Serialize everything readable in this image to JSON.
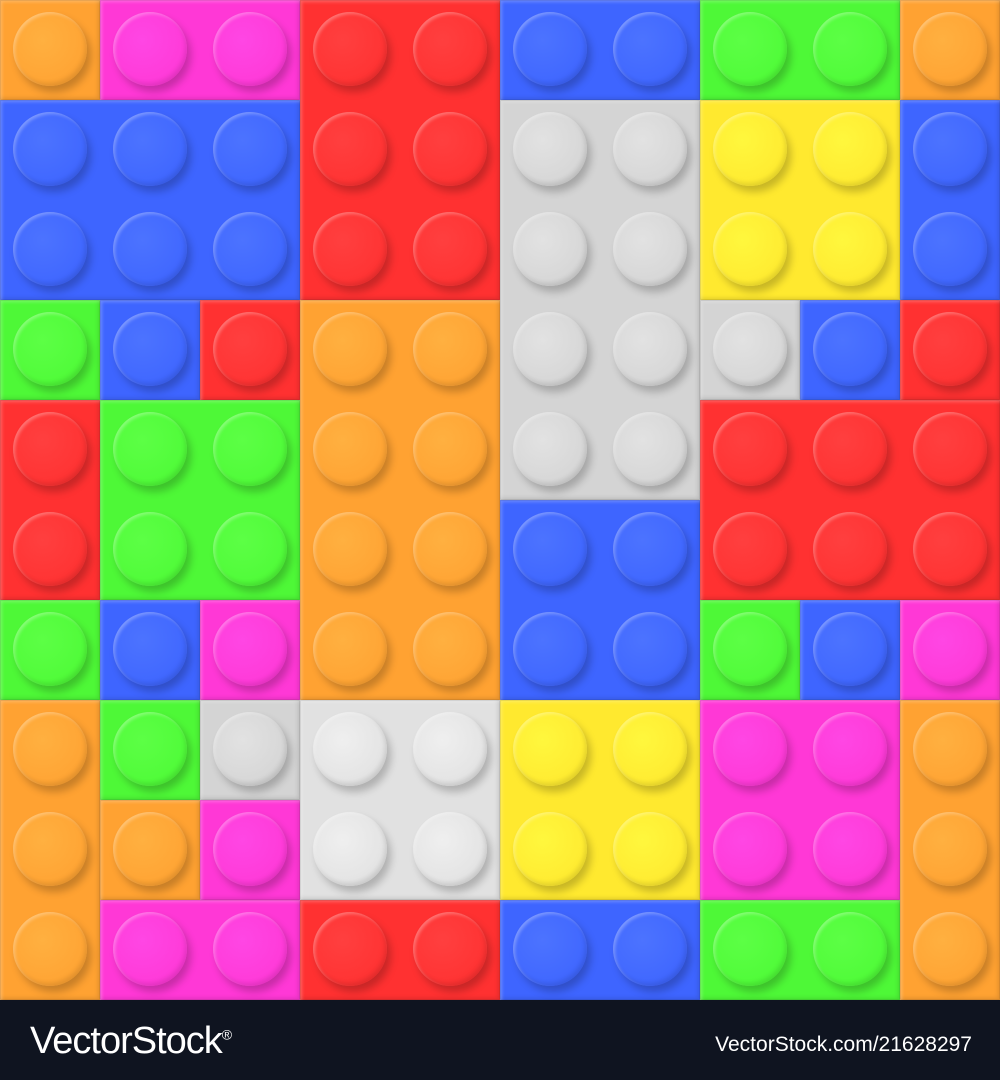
{
  "colors": {
    "orange": "#FFA232",
    "magenta": "#FF38D6",
    "red": "#FF3131",
    "blue": "#3E65FF",
    "green": "#4EF837",
    "gray": "#D4D4D4",
    "yellow": "#FFE92F",
    "lightgray": "#E1E1E1",
    "footer_bg": "#0f1420",
    "footer_text": "#ffffff"
  },
  "bricks": [
    {
      "color": "orange",
      "studs": "1x1"
    },
    {
      "color": "magenta",
      "studs": "2x1"
    },
    {
      "color": "red",
      "studs": "2x3"
    },
    {
      "color": "blue",
      "studs": "2x1"
    },
    {
      "color": "green",
      "studs": "2x1"
    },
    {
      "color": "orange",
      "studs": "1x1"
    },
    {
      "color": "blue",
      "studs": "3x2"
    },
    {
      "color": "gray",
      "studs": "2x4"
    },
    {
      "color": "yellow",
      "studs": "2x2"
    },
    {
      "color": "blue",
      "studs": "1x2"
    },
    {
      "color": "green",
      "studs": "1x1"
    },
    {
      "color": "blue",
      "studs": "1x1"
    },
    {
      "color": "red",
      "studs": "1x1"
    },
    {
      "color": "orange",
      "studs": "2x4"
    },
    {
      "color": "gray",
      "studs": "1x1"
    },
    {
      "color": "blue",
      "studs": "1x1"
    },
    {
      "color": "red",
      "studs": "1x1"
    },
    {
      "color": "red",
      "studs": "1x2"
    },
    {
      "color": "green",
      "studs": "2x2"
    },
    {
      "color": "red",
      "studs": "3x2"
    },
    {
      "color": "blue",
      "studs": "2x2"
    },
    {
      "color": "green",
      "studs": "1x1"
    },
    {
      "color": "blue",
      "studs": "1x1"
    },
    {
      "color": "magenta",
      "studs": "1x1"
    },
    {
      "color": "green",
      "studs": "1x1"
    },
    {
      "color": "blue",
      "studs": "1x1"
    },
    {
      "color": "magenta",
      "studs": "1x1"
    },
    {
      "color": "orange",
      "studs": "1x3"
    },
    {
      "color": "green",
      "studs": "1x1"
    },
    {
      "color": "gray",
      "studs": "1x1"
    },
    {
      "color": "lightgray",
      "studs": "2x2"
    },
    {
      "color": "yellow",
      "studs": "2x2"
    },
    {
      "color": "magenta",
      "studs": "2x2"
    },
    {
      "color": "orange",
      "studs": "1x3"
    },
    {
      "color": "orange",
      "studs": "1x1"
    },
    {
      "color": "magenta",
      "studs": "1x1"
    },
    {
      "color": "magenta",
      "studs": "2x1"
    },
    {
      "color": "red",
      "studs": "2x1"
    },
    {
      "color": "blue",
      "studs": "2x1"
    },
    {
      "color": "green",
      "studs": "2x1"
    }
  ],
  "footer": {
    "brand": "VectorStock",
    "brand_mark": "®",
    "image_id": "VectorStock.com/21628297"
  }
}
